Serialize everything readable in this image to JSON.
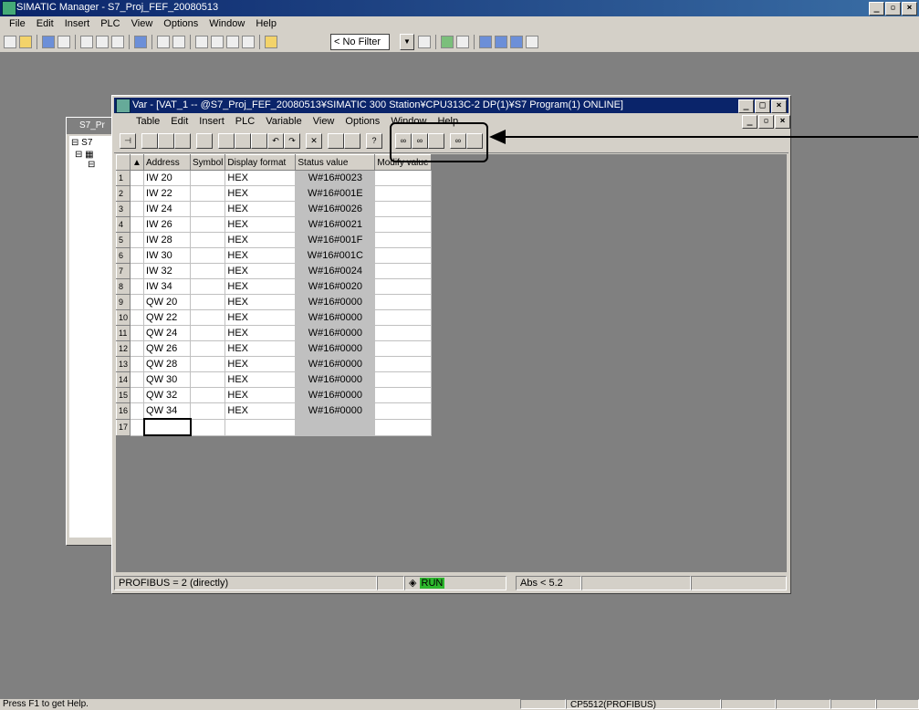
{
  "main": {
    "title": "SIMATIC Manager - S7_Proj_FEF_20080513",
    "menu": [
      "File",
      "Edit",
      "Insert",
      "PLC",
      "View",
      "Options",
      "Window",
      "Help"
    ],
    "filter": "< No Filter >",
    "status_text": "Press F1 to get Help.",
    "status_panel": "CP5512(PROFIBUS)"
  },
  "bg_window": {
    "title": "S7_Pr",
    "tree_root": "S7"
  },
  "var_window": {
    "title": "Var - [VAT_1 -- @S7_Proj_FEF_20080513¥SIMATIC 300 Station¥CPU313C-2 DP(1)¥S7 Program(1)  ONLINE]",
    "menu": [
      "Table",
      "Edit",
      "Insert",
      "PLC",
      "Variable",
      "View",
      "Options",
      "Window",
      "Help"
    ],
    "columns": [
      "Address",
      "Symbol",
      "Display format",
      "Status value",
      "Modify value"
    ],
    "rows": [
      {
        "n": "1",
        "addr": "IW   20",
        "fmt": "HEX",
        "status": "W#16#0023"
      },
      {
        "n": "2",
        "addr": "IW   22",
        "fmt": "HEX",
        "status": "W#16#001E"
      },
      {
        "n": "3",
        "addr": "IW   24",
        "fmt": "HEX",
        "status": "W#16#0026"
      },
      {
        "n": "4",
        "addr": "IW   26",
        "fmt": "HEX",
        "status": "W#16#0021"
      },
      {
        "n": "5",
        "addr": "IW   28",
        "fmt": "HEX",
        "status": "W#16#001F"
      },
      {
        "n": "6",
        "addr": "IW   30",
        "fmt": "HEX",
        "status": "W#16#001C"
      },
      {
        "n": "7",
        "addr": "IW   32",
        "fmt": "HEX",
        "status": "W#16#0024"
      },
      {
        "n": "8",
        "addr": "IW   34",
        "fmt": "HEX",
        "status": "W#16#0020"
      },
      {
        "n": "9",
        "addr": "QW   20",
        "fmt": "HEX",
        "status": "W#16#0000"
      },
      {
        "n": "10",
        "addr": "QW   22",
        "fmt": "HEX",
        "status": "W#16#0000"
      },
      {
        "n": "11",
        "addr": "QW   24",
        "fmt": "HEX",
        "status": "W#16#0000"
      },
      {
        "n": "12",
        "addr": "QW   26",
        "fmt": "HEX",
        "status": "W#16#0000"
      },
      {
        "n": "13",
        "addr": "QW   28",
        "fmt": "HEX",
        "status": "W#16#0000"
      },
      {
        "n": "14",
        "addr": "QW   30",
        "fmt": "HEX",
        "status": "W#16#0000"
      },
      {
        "n": "15",
        "addr": "QW   32",
        "fmt": "HEX",
        "status": "W#16#0000"
      },
      {
        "n": "16",
        "addr": "QW   34",
        "fmt": "HEX",
        "status": "W#16#0000"
      },
      {
        "n": "17",
        "addr": "",
        "fmt": "",
        "status": ""
      }
    ],
    "status_profibus": "PROFIBUS =  2 (directly)",
    "status_run": "RUN",
    "status_abs": "Abs < 5.2"
  }
}
